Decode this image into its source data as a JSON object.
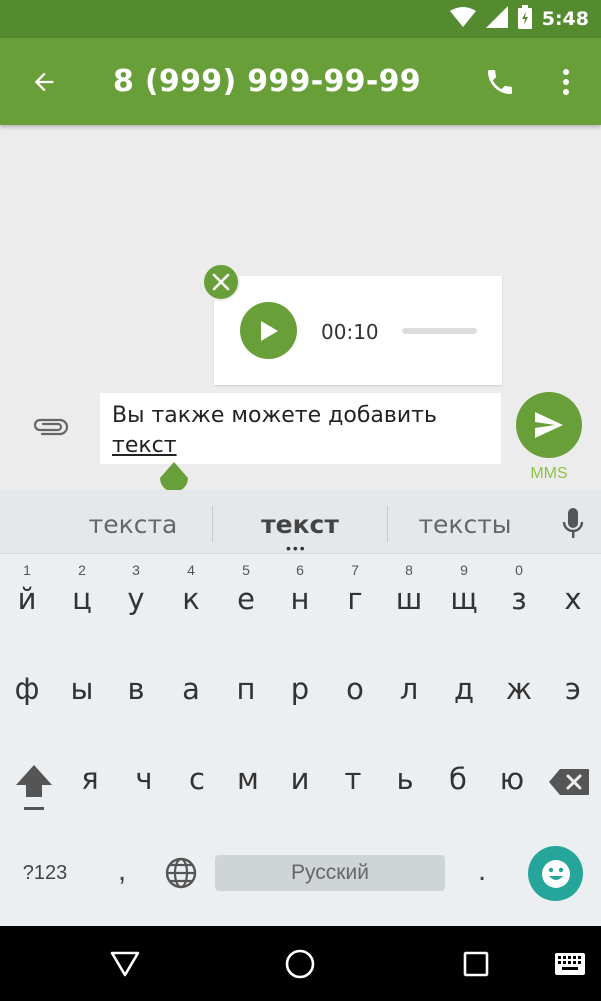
{
  "status_bar": {
    "time": "5:48"
  },
  "app_bar": {
    "title": "8 (999) 999-99-99"
  },
  "attachment": {
    "duration": "00:10"
  },
  "compose": {
    "text_main": "Вы также можете добавить ",
    "text_underlined": "текст",
    "send_label": "MMS"
  },
  "keyboard": {
    "suggestions": [
      "текста",
      "текст",
      "тексты"
    ],
    "row1": [
      {
        "ch": "й",
        "hint": "1"
      },
      {
        "ch": "ц",
        "hint": "2"
      },
      {
        "ch": "у",
        "hint": "3"
      },
      {
        "ch": "к",
        "hint": "4"
      },
      {
        "ch": "е",
        "hint": "5"
      },
      {
        "ch": "н",
        "hint": "6"
      },
      {
        "ch": "г",
        "hint": "7"
      },
      {
        "ch": "ш",
        "hint": "8"
      },
      {
        "ch": "щ",
        "hint": "9"
      },
      {
        "ch": "з",
        "hint": "0"
      },
      {
        "ch": "х",
        "hint": ""
      }
    ],
    "row2": [
      "ф",
      "ы",
      "в",
      "а",
      "п",
      "р",
      "о",
      "л",
      "д",
      "ж",
      "э"
    ],
    "row3": [
      "я",
      "ч",
      "с",
      "м",
      "и",
      "т",
      "ь",
      "б",
      "ю"
    ],
    "symbols_label": "?123",
    "comma": ",",
    "space_label": "Русский",
    "period": "."
  },
  "colors": {
    "primary": "#689f38",
    "primary_dark": "#558b2f",
    "accent_light": "#8bc34a",
    "emoji": "#26a69a"
  }
}
